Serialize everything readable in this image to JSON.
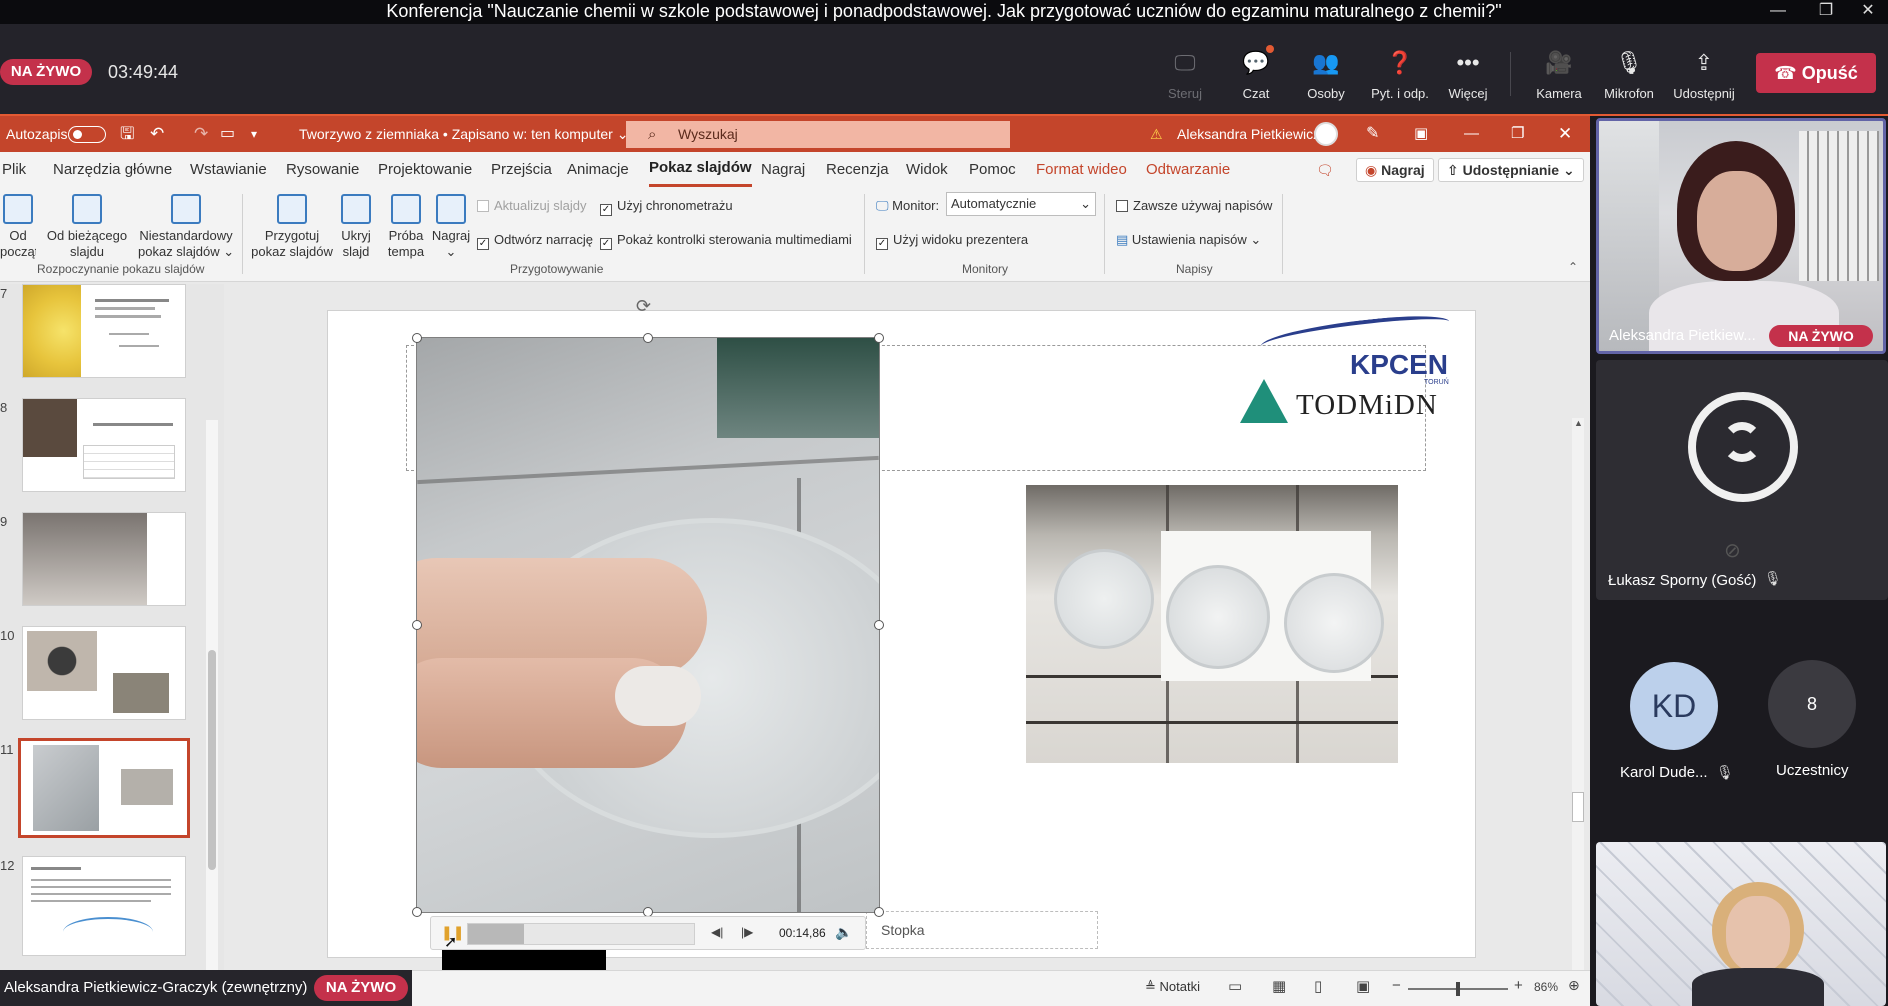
{
  "window": {
    "title": "Konferencja \"Nauczanie chemii w szkole podstawowej i ponadpodstawowej. Jak przygotować uczniów do egzaminu maturalnego z chemii?\""
  },
  "meeting": {
    "live_label": "NA ŻYWO",
    "timer": "03:49:44",
    "controls": {
      "control": "Steruj",
      "chat": "Czat",
      "people": "Osoby",
      "qa": "Pyt. i odp.",
      "more": "Więcej",
      "camera": "Kamera",
      "mic": "Mikrofon",
      "share": "Udostępnij",
      "leave": "Opuść"
    },
    "presenter_bar": {
      "name": "Aleksandra Pietkiewicz-Graczyk (zewnętrzny)",
      "live_label": "NA ŻYWO"
    }
  },
  "ppt": {
    "autosave_label": "Autozapis",
    "file_title": "Tworzywo z ziemniaka • Zapisano w: ten komputer",
    "search_placeholder": "Wyszukaj",
    "user": "Aleksandra Pietkiewicz",
    "menu": [
      "Plik",
      "Narzędzia główne",
      "Wstawianie",
      "Rysowanie",
      "Projektowanie",
      "Przejścia",
      "Animacje",
      "Pokaz slajdów",
      "Nagraj",
      "Recenzja",
      "Widok",
      "Pomoc",
      "Format wideo",
      "Odtwarzanie"
    ],
    "record_btn": "Nagraj",
    "share_btn": "Udostępnianie",
    "ribbon": {
      "from_start": [
        "Od",
        "początku"
      ],
      "from_current": [
        "Od bieżącego",
        "slajdu"
      ],
      "custom_show": [
        "Niestandardowy",
        "pokaz slajdów"
      ],
      "group_start": "Rozpoczynanie pokazu slajdów",
      "setup_show": [
        "Przygotuj",
        "pokaz slajdów"
      ],
      "hide_slide": [
        "Ukryj",
        "slajd"
      ],
      "rehearse": [
        "Próba",
        "tempa"
      ],
      "record": "Nagraj",
      "update_slides": "Aktualizuj slajdy",
      "use_timings": "Użyj chronometrażu",
      "play_narration": "Odtwórz narrację",
      "show_media_controls": "Pokaż kontrolki sterowania multimediami",
      "group_setup": "Przygotowywanie",
      "monitor_label": "Monitor:",
      "monitor_value": "Automatycznie",
      "presenter_view": "Użyj widoku prezentera",
      "group_monitors": "Monitory",
      "always_captions": "Zawsze używaj napisów",
      "caption_settings": "Ustawienia napisów",
      "group_captions": "Napisy"
    },
    "thumbnails": [
      {
        "num": "7"
      },
      {
        "num": "8"
      },
      {
        "num": "9"
      },
      {
        "num": "10"
      },
      {
        "num": "11"
      },
      {
        "num": "12"
      }
    ],
    "slide": {
      "logo_top": "KPCEN",
      "logo_small": "TORUŃ",
      "logo_bottom": "TODMiDN",
      "footer_placeholder": "Stopka",
      "video_time": "00:14,86"
    },
    "status": {
      "notes": "Notatki",
      "zoom": "86%"
    }
  },
  "participants": [
    {
      "name": "Aleksandra Pietkiew...",
      "badge": "NA ŻYWO"
    },
    {
      "name": "Łukasz Sporny (Gość)"
    },
    {
      "name": "Karol Dude...",
      "initials": "KD"
    },
    {
      "name": "Uczestnicy",
      "count": "8"
    }
  ],
  "colors": {
    "ppt_accent": "#c4452b",
    "teams_live": "#c4314b",
    "teams_bg": "#24232a"
  }
}
